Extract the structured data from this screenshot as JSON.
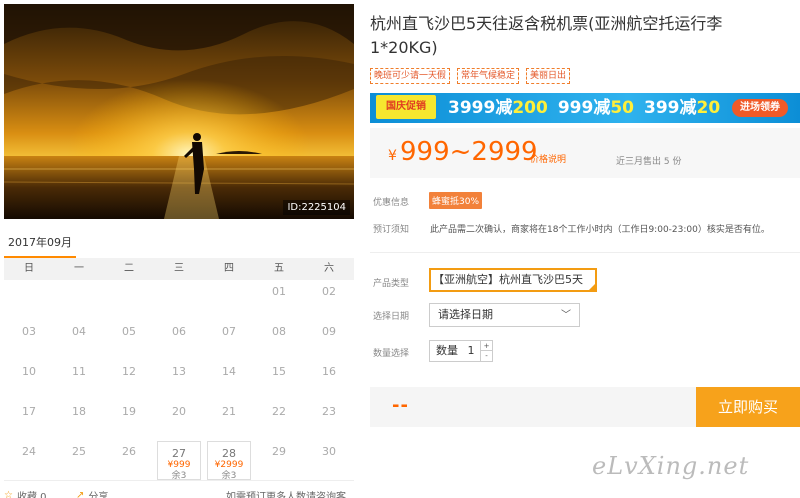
{
  "product": {
    "title": "杭州直飞沙巴5天往返含税机票(亚洲航空托运行李1*20KG)",
    "tags": [
      "晚班可少请一天假",
      "常年气候稳定",
      "美丽日出"
    ],
    "photo_id": "ID:2225104"
  },
  "promo": {
    "badge": "国庆促销",
    "offers": [
      {
        "base": "3999减",
        "off": "200"
      },
      {
        "base": "999减",
        "off": "50"
      },
      {
        "base": "399减",
        "off": "20"
      }
    ],
    "button": "进场领券"
  },
  "price": {
    "currency": "¥",
    "range": "999~2999",
    "note": "价格说明",
    "sold": "近三月售出 5 份"
  },
  "info": {
    "discount_label": "优惠信息",
    "discount_tag": "蜂蜜抵30%",
    "notice_label": "预订须知",
    "notice_text": "此产品需二次确认，商家将在18个工作小时内（工作日9:00-23:00）核实是否有位。"
  },
  "form": {
    "type_label": "产品类型",
    "type_value": "【亚洲航空】杭州直飞沙巴5天",
    "date_label": "选择日期",
    "date_placeholder": "请选择日期",
    "qty_label": "数量选择",
    "qty_text": "数量",
    "qty_value": "1",
    "qty_up": "+",
    "qty_down": "-"
  },
  "buy": {
    "price_placeholder": "--",
    "button": "立即购买"
  },
  "calendar": {
    "month": "2017年09月",
    "weekdays": [
      "日",
      "一",
      "二",
      "三",
      "四",
      "五",
      "六"
    ],
    "cells": [
      {
        "d": ""
      },
      {
        "d": ""
      },
      {
        "d": ""
      },
      {
        "d": ""
      },
      {
        "d": ""
      },
      {
        "d": "01"
      },
      {
        "d": "02"
      },
      {
        "d": "03"
      },
      {
        "d": "04"
      },
      {
        "d": "05"
      },
      {
        "d": "06"
      },
      {
        "d": "07"
      },
      {
        "d": "08"
      },
      {
        "d": "09"
      },
      {
        "d": "10"
      },
      {
        "d": "11"
      },
      {
        "d": "12"
      },
      {
        "d": "13"
      },
      {
        "d": "14"
      },
      {
        "d": "15"
      },
      {
        "d": "16"
      },
      {
        "d": "17"
      },
      {
        "d": "18"
      },
      {
        "d": "19"
      },
      {
        "d": "20"
      },
      {
        "d": "21"
      },
      {
        "d": "22"
      },
      {
        "d": "23"
      },
      {
        "d": "24"
      },
      {
        "d": "25"
      },
      {
        "d": "26"
      },
      {
        "d": "27",
        "price": "¥999",
        "stock": "余3"
      },
      {
        "d": "28",
        "price": "¥2999",
        "stock": "余3"
      },
      {
        "d": "29"
      },
      {
        "d": "30"
      }
    ]
  },
  "actions": {
    "favorite": "收藏 0",
    "share": "分享",
    "note": "如需预订更多人数请咨询客服"
  },
  "watermark": "eLvXing.net"
}
